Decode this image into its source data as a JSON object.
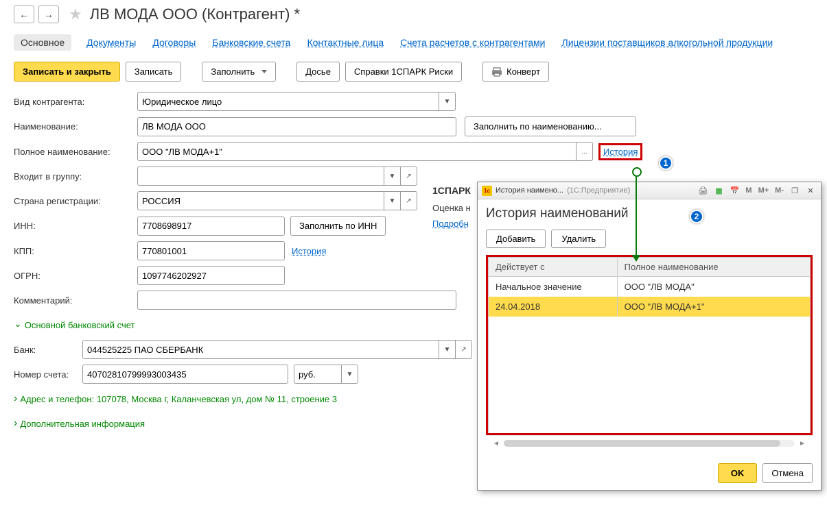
{
  "header": {
    "title": "ЛВ МОДА ООО (Контрагент) *"
  },
  "tabs": [
    "Основное",
    "Документы",
    "Договоры",
    "Банковские счета",
    "Контактные лица",
    "Счета расчетов с контрагентами",
    "Лицензии поставщиков алкогольной продукции"
  ],
  "activeTab": 0,
  "commands": {
    "save_close": "Записать и закрыть",
    "save": "Записать",
    "fill": "Заполнить",
    "dossier": "Досье",
    "spark": "Справки 1СПАРК Риски",
    "convert": "Конверт"
  },
  "form": {
    "type_label": "Вид контрагента:",
    "type_value": "Юридическое лицо",
    "name_label": "Наименование:",
    "name_value": "ЛВ МОДА ООО",
    "fill_by_name": "Заполнить по наименованию...",
    "fullname_label": "Полное наименование:",
    "fullname_value": "ООО \"ЛВ МОДА+1\"",
    "history_link": "История",
    "group_label": "Входит в группу:",
    "country_label": "Страна регистрации:",
    "country_value": "РОССИЯ",
    "inn_label": "ИНН:",
    "inn_value": "7708698917",
    "fill_by_inn": "Заполнить по ИНН",
    "kpp_label": "КПП:",
    "kpp_value": "770801001",
    "kpp_history": "История",
    "ogrn_label": "ОГРН:",
    "ogrn_value": "1097746202927",
    "comment_label": "Комментарий:",
    "bank_section": "Основной банковский счет",
    "bank_label": "Банк:",
    "bank_value": "044525225 ПАО СБЕРБАНК",
    "account_label": "Номер счета:",
    "account_value": "40702810799993003435",
    "currency": "руб.",
    "address_section": "Адрес и телефон: 107078, Москва г, Каланчевская ул, дом № 11, строение 3",
    "extra_section": "Дополнительная информация"
  },
  "spark": {
    "title": "1СПАРК",
    "rating": "Оценка н",
    "more": "Подробн"
  },
  "popup": {
    "titlebar": "История наимено...",
    "titlebar_grey": "(1С:Предприятие)",
    "heading": "История наименований",
    "add": "Добавить",
    "delete": "Удалить",
    "col1": "Действует с",
    "col2": "Полное наименование",
    "rows": [
      {
        "date": "Начальное значение",
        "name": "ООО \"ЛВ МОДА\""
      },
      {
        "date": "24.04.2018",
        "name": "ООО \"ЛВ МОДА+1\""
      }
    ],
    "ok": "OK",
    "cancel": "Отмена"
  },
  "callouts": {
    "c1": "1",
    "c2": "2"
  }
}
